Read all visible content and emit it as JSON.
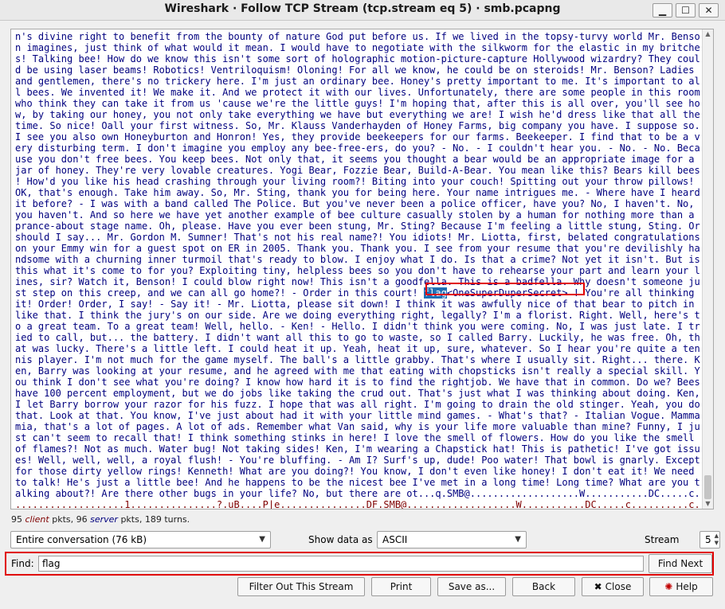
{
  "window": {
    "title": "Wireshark · Follow TCP Stream (tcp.stream eq 5) · smb.pcapng",
    "minimize": "▁",
    "maximize": "☐",
    "close": "✕"
  },
  "stream": {
    "lines": [
      "n's divine right to benefit from the bounty of nature God put before us. If we lived in the topsy-turvy world Mr. Benso",
      "n imagines, just think of what would it mean. I would have to negotiate with the silkworm for the elastic in my britche",
      "s! Talking bee! How do we know this isn't some sort of holographic motion-picture-capture Hollywood wizardry? They coul",
      "d be using laser beams! Robotics! Ventriloquism! Oloning! For all we know, he could be on steroids! Mr. Benson? Ladies",
      "and gentlemen, there's no trickery here. I'm just an ordinary bee. Honey's pretty important to me. It's important to al",
      "l bees. We invented it! We make it. And we protect it with our lives. Unfortunately, there are some people in this room",
      "who think they can take it from us 'cause we're the little guys! I'm hoping that, after this is all over, you'll see ho",
      "w, by taking our honey, you not only take everything we have but everything we are! I wish he'd dress like that all the",
      "time. So nice! Oall your first witness. So, Mr. Klauss Vanderhayden of Honey Farms, big company you have. I suppose so.",
      "I see you also own Honeyburton and Honron! Yes, they provide beekeepers for our farms. Beekeeper. I find that to be a v",
      "ery disturbing term. I don't imagine you employ any bee-free-ers, do you? - No. - I couldn't hear you. - No. - No. Beca",
      "use you don't free bees. You keep bees. Not only that, it seems you thought a bear would be an appropriate image for a",
      "jar of honey. They're very lovable creatures. Yogi Bear, Fozzie Bear, Build-A-Bear. You mean like this? Bears kill bees",
      "! How'd you like his head crashing through your living room?! Biting into your couch! Spitting out your throw pillows!",
      "OK, that's enough. Take him away. So, Mr. Sting, thank you for being here. Your name intrigues me. - Where have I heard",
      "it before? - I was with a band called The Police. But you've never been a police officer, have you? No, I haven't. No,",
      "you haven't. And so here we have yet another example of bee culture casually stolen by a human for nothing more than a",
      "prance-about stage name. Oh, please. Have you ever been stung, Mr. Sting? Because I'm feeling a little stung, Sting. Or",
      "should I say... Mr. Gordon M. Sumner! That's not his real name?! You idiots! Mr. Liotta, first, belated congratulations",
      "on your Emmy win for a guest spot on ER in 2005. Thank you. Thank you. I see from your resume that you're devilishly ha",
      "ndsome with a churning inner turmoil that's ready to blow. I enjoy what I do. Is that a crime? Not yet it isn't. But is",
      "this what it's come to for you? Exploiting tiny, helpless bees so you don't have to rehearse your part and learn your l",
      "ines, sir? Watch it, Benson! I could blow right now! This isn't a goodfella. This is a badfella. Why doesn't someone ju",
      "st step on this creep, and we can all go home?! - Order in this court! flag<OneSuperDuperSecret> ! You're all thinking",
      "it! Order! Order, I say! - Say it! - Mr. Liotta, please sit down! I think it was awfully nice of that bear to pitch in",
      "like that. I think the jury's on our side. Are we doing everything right, legally? I'm a florist. Right. Well, here's t",
      "o a great team. To a great team! Well, hello. - Ken! - Hello. I didn't think you were coming. No, I was just late. I tr",
      "ied to call, but... the battery. I didn't want all this to go to waste, so I called Barry. Luckily, he was free. Oh, th",
      "at was lucky. There's a little left. I could heat it up. Yeah, heat it up, sure, whatever. So I hear you're quite a ten",
      "nis player. I'm not much for the game myself. The ball's a little grabby. That's where I usually sit. Right... there. K",
      "en, Barry was looking at your resume, and he agreed with me that eating with chopsticks isn't really a special skill. Y",
      "ou think I don't see what you're doing? I know how hard it is to find the rightjob. We have that in common. Do we? Bees",
      "have 100 percent employment, but we do jobs like taking the crud out. That's just what I was thinking about doing. Ken,",
      "I let Barry borrow your razor for his fuzz. I hope that was all right. I'm going to drain the old stinger. Yeah, you do",
      "that. Look at that. You know, I've just about had it with your little mind games. - What's that? - Italian Vogue. Mamma",
      "mia, that's a lot of pages. A lot of ads. Remember what Van said, why is your life more valuable than mine? Funny, I ju",
      "st can't seem to recall that! I think something stinks in here! I love the smell of flowers. How do you like the smell",
      "of flames?! Not as much. Water bug! Not taking sides! Ken, I'm wearing a Chapstick hat! This is pathetic! I've got issu",
      "es! Well, well, well, a royal flush! - You're bluffing. - Am I? Surf's up, dude! Poo water! That bowl is gnarly. Except",
      "for those dirty yellow rings! Kenneth! What are you doing?! You know, I don't even like honey! I don't eat it! We need",
      "to talk! He's just a little bee! And he happens to be the nicest bee I've met in a long time! Long time? What are you t",
      "alking about?! Are there other bugs in your life? No, but there are ot...q.SMB@...................W...........DC.....c.",
      "...................1...............?.uB....P|e...............DF.SMB@...................W...........DC.....c..........c."
    ],
    "match_line_index": 23,
    "match_before": "st step on this creep, and we can all go home?! - Order in this court! ",
    "match_text": "flag",
    "match_after": "<OneSuperDuperSecret> ! You're all thinking"
  },
  "stats": {
    "client_count": "95",
    "client_word": "client",
    "server_count": "96",
    "server_word": "server",
    "tail": "189 turns."
  },
  "controls": {
    "conversation": "Entire conversation (76 kB)",
    "show_data_label": "Show data as",
    "show_data_value": "ASCII",
    "stream_label": "Stream",
    "stream_value": "5"
  },
  "find": {
    "label": "Find:",
    "value": "flag",
    "button": "Find Next"
  },
  "buttons": {
    "filter_out": "Filter Out This Stream",
    "print": "Print",
    "save_as": "Save as...",
    "back": "Back",
    "close": "Close",
    "help": "Help"
  },
  "colors": {
    "client_text": "#00007f",
    "server_text": "#7f0000",
    "match_bg": "#1f6fb5",
    "highlight_border": "#e00000"
  }
}
